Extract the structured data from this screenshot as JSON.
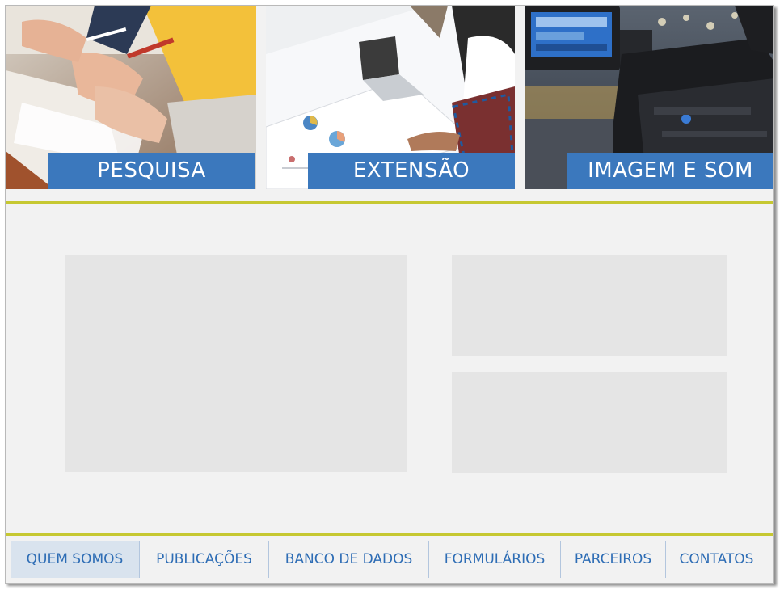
{
  "hero_tiles": [
    {
      "label": "PESQUISA",
      "image": "students-writing-photo"
    },
    {
      "label": "EXTENSÃO",
      "image": "laptop-meeting-photo"
    },
    {
      "label": "IMAGEM E SOM",
      "image": "video-camera-photo"
    }
  ],
  "nav": {
    "items": [
      {
        "label": "QUEM SOMOS",
        "active": true
      },
      {
        "label": "PUBLICAÇÕES",
        "active": false
      },
      {
        "label": "BANCO DE DADOS",
        "active": false
      },
      {
        "label": "FORMULÁRIOS",
        "active": false
      },
      {
        "label": "PARCEIROS",
        "active": false
      },
      {
        "label": "CONTATOS",
        "active": false
      }
    ]
  },
  "colors": {
    "label_bg": "#3b78bd",
    "rule": "#c6c832",
    "nav_text": "#2e6db5",
    "nav_active_bg": "#d9e3ee",
    "placeholder": "#e5e5e5",
    "page_bg": "#f2f2f2"
  }
}
